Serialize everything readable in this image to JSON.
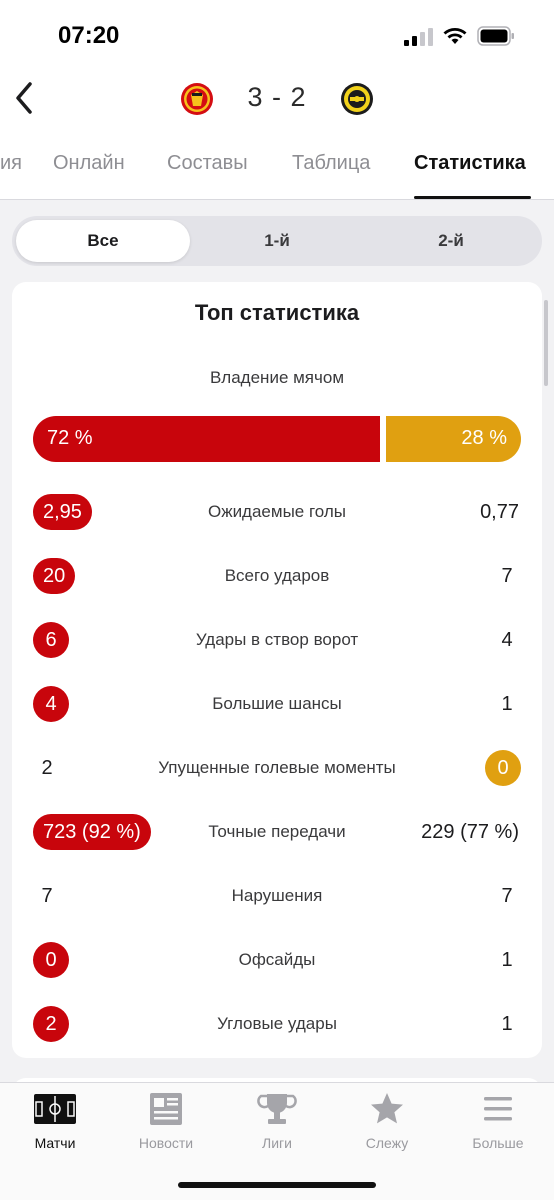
{
  "status": {
    "time": "07:20"
  },
  "match": {
    "home_score": "3",
    "separator": "-",
    "away_score": "2"
  },
  "tabs": [
    {
      "label": "ия"
    },
    {
      "label": "Онлайн"
    },
    {
      "label": "Составы"
    },
    {
      "label": "Таблица"
    },
    {
      "label": "Статистика"
    }
  ],
  "segments": [
    {
      "label": "Все"
    },
    {
      "label": "1-й"
    },
    {
      "label": "2-й"
    }
  ],
  "stats": {
    "title": "Топ статистика",
    "possession": {
      "label": "Владение мячом",
      "home": "72 %",
      "away": "28 %",
      "home_fraction": 0.72,
      "away_fraction": 0.28
    },
    "rows": [
      {
        "label": "Ожидаемые голы",
        "home": "2,95",
        "away": "0,77",
        "leader": "home"
      },
      {
        "label": "Всего ударов",
        "home": "20",
        "away": "7",
        "leader": "home"
      },
      {
        "label": "Удары в створ ворот",
        "home": "6",
        "away": "4",
        "leader": "home"
      },
      {
        "label": "Большие шансы",
        "home": "4",
        "away": "1",
        "leader": "home"
      },
      {
        "label": "Упущенные голевые моменты",
        "home": "2",
        "away": "0",
        "leader": "away"
      },
      {
        "label": "Точные передачи",
        "home": "723 (92 %)",
        "away": "229 (77 %)",
        "leader": "home"
      },
      {
        "label": "Нарушения",
        "home": "7",
        "away": "7",
        "leader": "none"
      },
      {
        "label": "Офсайды",
        "home": "0",
        "away": "1",
        "leader": "home"
      },
      {
        "label": "Угловые удары",
        "home": "2",
        "away": "1",
        "leader": "home"
      }
    ]
  },
  "tabbar": [
    {
      "label": "Матчи",
      "icon": "pitch-icon",
      "active": true
    },
    {
      "label": "Новости",
      "icon": "news-icon",
      "active": false
    },
    {
      "label": "Лиги",
      "icon": "trophy-icon",
      "active": false
    },
    {
      "label": "Слежу",
      "icon": "star-icon",
      "active": false
    },
    {
      "label": "Больше",
      "icon": "menu-icon",
      "active": false
    }
  ],
  "colors": {
    "home_accent": "#c8050c",
    "away_accent": "#e0a011"
  }
}
